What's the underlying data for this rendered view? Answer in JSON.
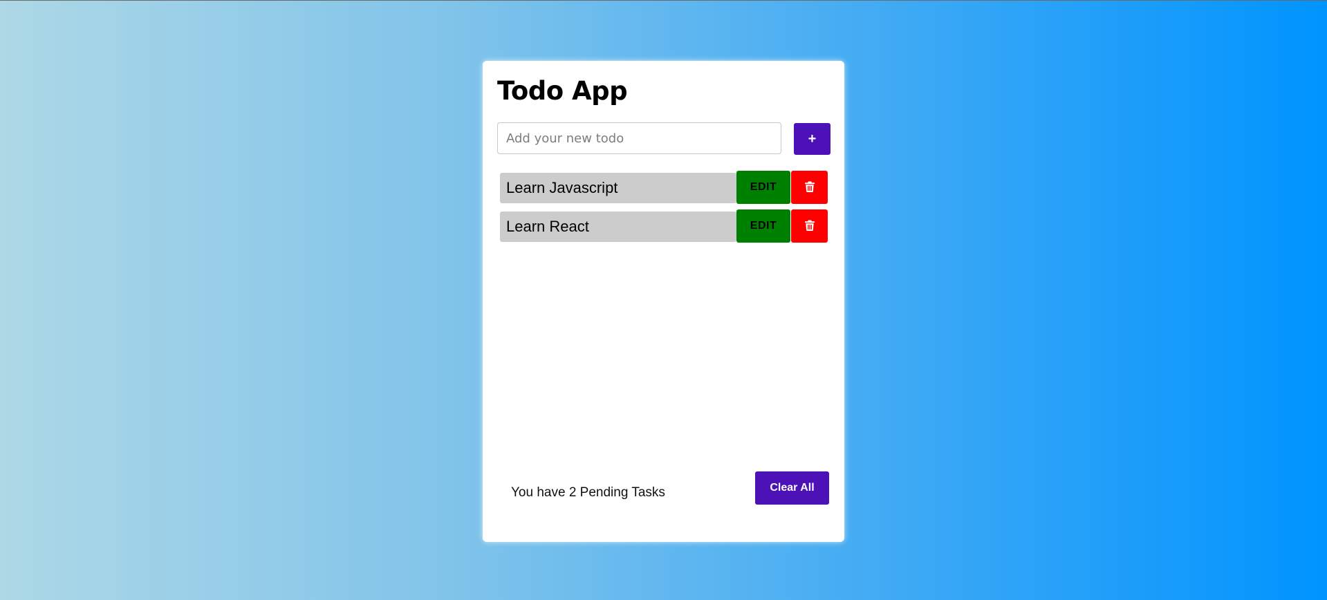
{
  "app": {
    "title": "Todo App"
  },
  "input": {
    "placeholder": "Add your new todo",
    "value": ""
  },
  "add_button": {
    "label": "+"
  },
  "todos": [
    {
      "text": "Learn Javascript",
      "edit_label": "EDIT",
      "delete_icon": "trash-icon"
    },
    {
      "text": "Learn React",
      "edit_label": "EDIT",
      "delete_icon": "trash-icon"
    }
  ],
  "footer": {
    "pending_text": "You have 2 Pending Tasks",
    "clear_label": "Clear All"
  },
  "colors": {
    "accent": "#4d12b7",
    "edit": "#008000",
    "delete": "#ff0000",
    "item_background": "#cccccc"
  }
}
